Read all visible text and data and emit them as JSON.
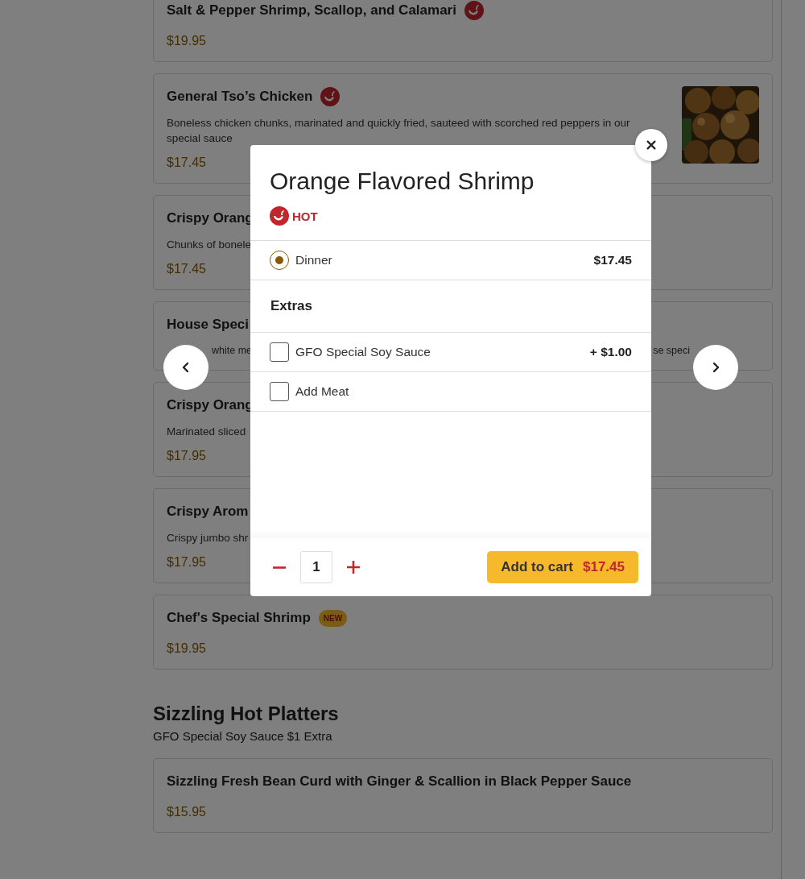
{
  "menu_items": [
    {
      "name": "Salt & Pepper Shrimp, Scallop, and Calamari",
      "spicy": true,
      "price": "$19.95"
    },
    {
      "name": "General Tso’s Chicken",
      "spicy": true,
      "description": "Boneless chicken chunks, marinated and quickly fried, sauteed with scorched red peppers in our special sauce",
      "price": "$17.45"
    },
    {
      "name": "Crispy Orang",
      "description": "Chunks of bonele",
      "price": "$17.45"
    },
    {
      "name": "House Speci",
      "description": "white me",
      "description_right": "se speci"
    },
    {
      "name": "Crispy Orang",
      "description": "Marinated sliced",
      "price": "$17.95"
    },
    {
      "name": "Crispy Arom",
      "description": "Crispy jumbo shr",
      "price": "$17.95"
    },
    {
      "name": "Chef's Special Shrimp",
      "badge": "NEW",
      "price": "$19.95"
    }
  ],
  "section": {
    "title": "Sizzling Hot Platters",
    "note": "GFO Special Soy Sauce $1 Extra",
    "items": [
      {
        "name": "Sizzling Fresh Bean Curd with Ginger & Scallion in Black Pepper Sauce",
        "price": "$15.95"
      }
    ]
  },
  "modal": {
    "title": "Orange Flavored Shrimp",
    "tag": "HOT",
    "sizes": [
      {
        "label": "Dinner",
        "price": "$17.45",
        "selected": true
      }
    ],
    "extras_heading": "Extras",
    "extras": [
      {
        "label": "GFO Special Soy Sauce",
        "price": "+ $1.00",
        "checked": false
      },
      {
        "label": "Add Meat",
        "checked": false
      }
    ],
    "quantity": "1",
    "add_button": {
      "label": "Add to cart",
      "price": "$17.45"
    }
  }
}
